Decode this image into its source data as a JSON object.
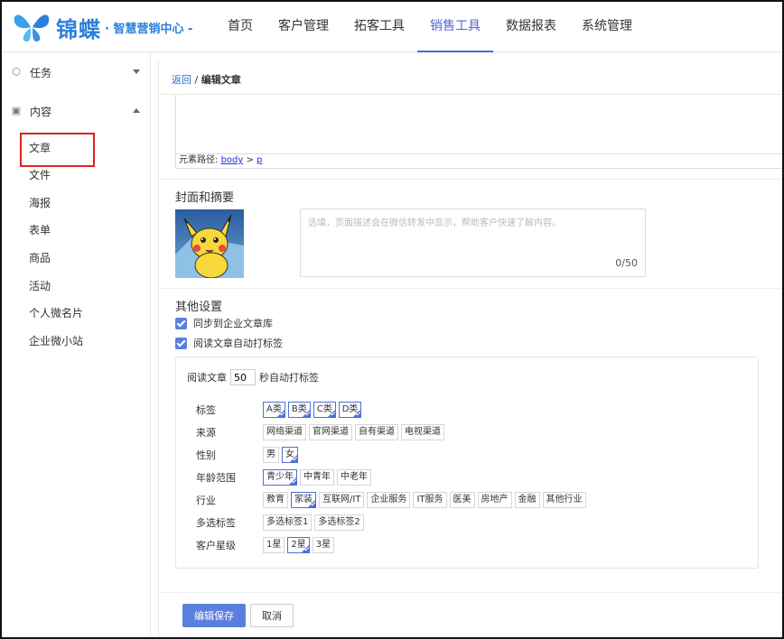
{
  "brand": {
    "name": "锦蝶",
    "subtitle": "· 智慧营销中心 -"
  },
  "nav": [
    "首页",
    "客户管理",
    "拓客工具",
    "销售工具",
    "数据报表",
    "系统管理"
  ],
  "sidebar": {
    "group_task": "任务",
    "group_content": "内容",
    "items": [
      "文章",
      "文件",
      "海报",
      "表单",
      "商品",
      "活动",
      "个人微名片",
      "企业微小站"
    ]
  },
  "breadcrumb": {
    "back": "返回",
    "sep": " / ",
    "current": "编辑文章"
  },
  "editor": {
    "path_label": "元素路径:",
    "path_body": "body",
    "path_gt": " > ",
    "path_p": "p"
  },
  "cover": {
    "title": "封面和摘要",
    "summary_placeholder": "选填，页面描述会在微信转发中显示，帮助客户快速了解内容。",
    "summary_count": "0/50"
  },
  "other": {
    "title": "其他设置",
    "sync_label": "同步到企业文章库",
    "auto_tag_label": "阅读文章自动打标签",
    "read_prefix": "阅读文章",
    "read_value": "50",
    "read_suffix": "秒自动打标签"
  },
  "tag_groups": [
    {
      "label": "标签",
      "tags": [
        "A类",
        "B类",
        "C类",
        "D类"
      ]
    },
    {
      "label": "来源",
      "tags": [
        "网络渠道",
        "官网渠道",
        "自有渠道",
        "电视渠道"
      ]
    },
    {
      "label": "性别",
      "tags": [
        "男",
        "女"
      ]
    },
    {
      "label": "年龄范围",
      "tags": [
        "青少年",
        "中青年",
        "中老年"
      ]
    },
    {
      "label": "行业",
      "tags": [
        "教育",
        "家装",
        "互联网/IT",
        "企业服务",
        "IT服务",
        "医美",
        "房地产",
        "金融",
        "其他行业"
      ]
    },
    {
      "label": "多选标签",
      "tags": [
        "多选标签1",
        "多选标签2"
      ]
    },
    {
      "label": "客户星级",
      "tags": [
        "1星",
        "2星",
        "3星"
      ]
    }
  ],
  "buttons": {
    "save": "编辑保存",
    "cancel": "取消"
  },
  "colors": {
    "accent": "#4f66d9",
    "button": "#5b7fe0",
    "link": "#2d6fd0",
    "highlight": "#e02020"
  }
}
